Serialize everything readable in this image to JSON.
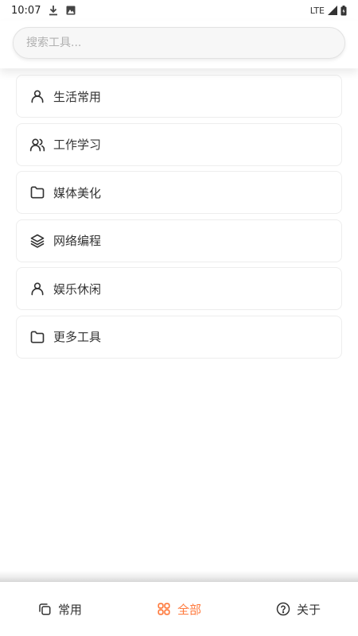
{
  "status_bar": {
    "time": "10:07",
    "network": "LTE",
    "icons": [
      "download-icon",
      "image-icon",
      "signal-icon",
      "battery-icon"
    ]
  },
  "search": {
    "placeholder": "搜索工具..."
  },
  "categories": [
    {
      "label": "生活常用",
      "icon": "person-icon"
    },
    {
      "label": "工作学习",
      "icon": "users-icon"
    },
    {
      "label": "媒体美化",
      "icon": "folder-icon"
    },
    {
      "label": "网络编程",
      "icon": "layers-icon"
    },
    {
      "label": "娱乐休闲",
      "icon": "person-icon"
    },
    {
      "label": "更多工具",
      "icon": "folder-icon"
    }
  ],
  "bottom_nav": {
    "items": [
      {
        "label": "常用",
        "icon": "copy-icon",
        "active": false
      },
      {
        "label": "全部",
        "icon": "grid-icon",
        "active": true
      },
      {
        "label": "关于",
        "icon": "help-circle-icon",
        "active": false
      }
    ],
    "active_color": "#ff7a3d",
    "inactive_color": "#333333"
  }
}
